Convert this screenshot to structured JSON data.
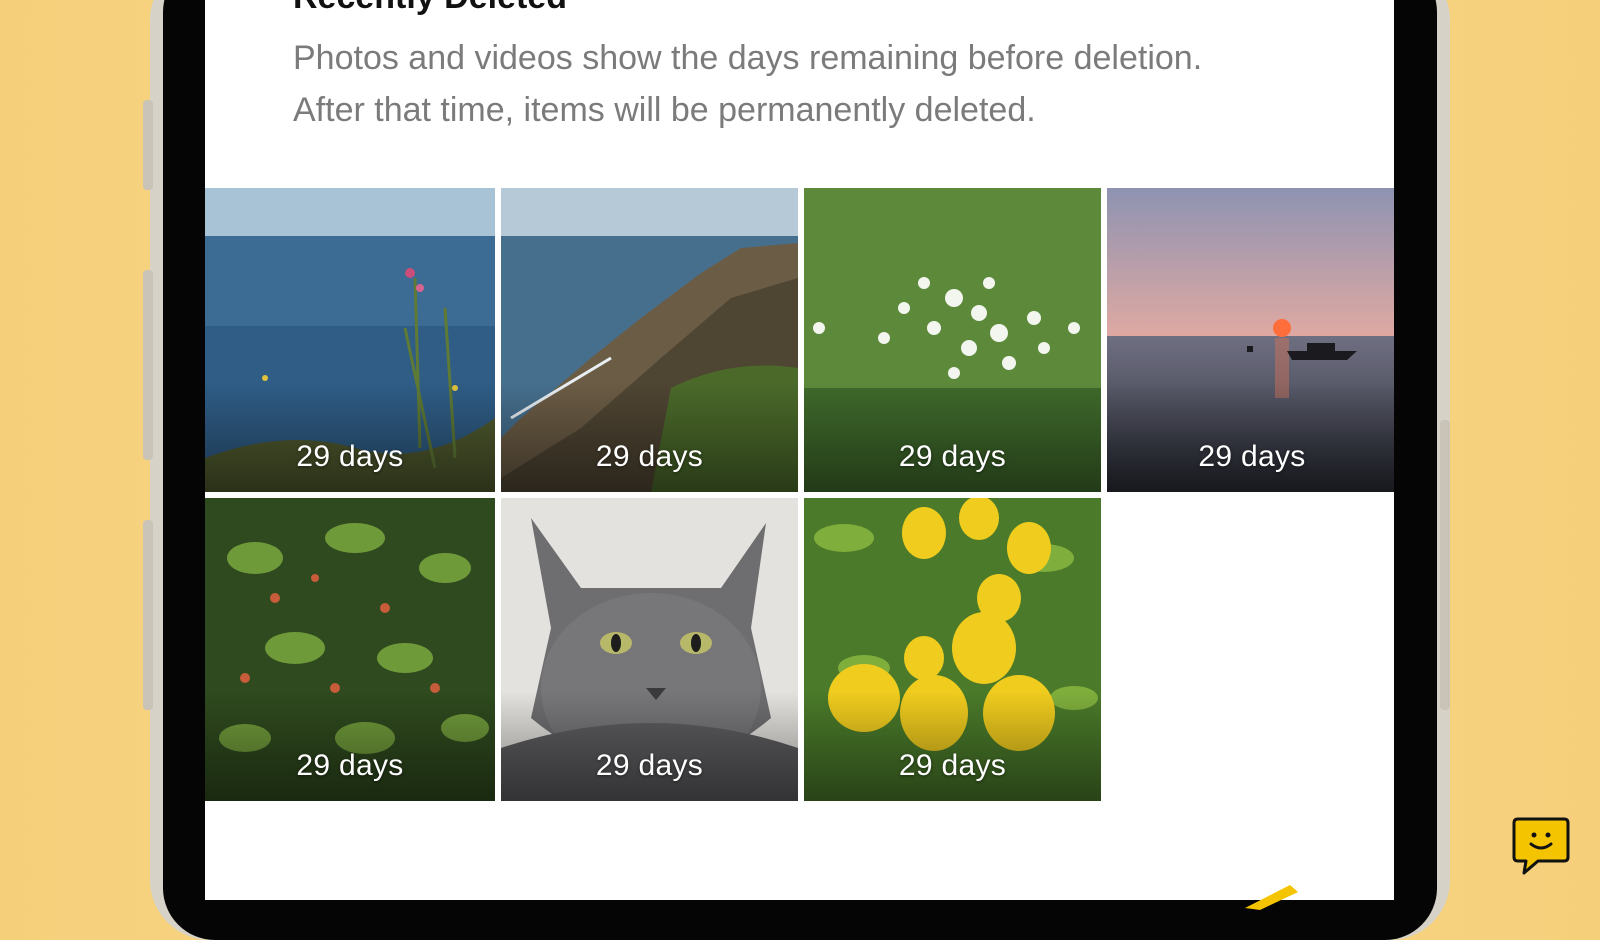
{
  "screen": {
    "heading_peek": "Recently Deleted",
    "description_lines": [
      "Photos and videos show the days remaining before deletion.",
      "After that time, items will be permanently deleted."
    ]
  },
  "grid": {
    "items": [
      {
        "label": "29 days",
        "subject": "sea-coast-flowers"
      },
      {
        "label": "29 days",
        "subject": "rocky-coastline"
      },
      {
        "label": "29 days",
        "subject": "white-flowers"
      },
      {
        "label": "29 days",
        "subject": "sunset-boat"
      },
      {
        "label": "29 days",
        "subject": "green-shrub"
      },
      {
        "label": "29 days",
        "subject": "gray-cat"
      },
      {
        "label": "29 days",
        "subject": "lemons"
      }
    ]
  },
  "fab": {
    "icon": "chat-smile-icon"
  },
  "colors": {
    "background": "#f9da8e",
    "accent": "#f5c400",
    "screen": "#ffffff",
    "description": "#7b7b7b"
  }
}
